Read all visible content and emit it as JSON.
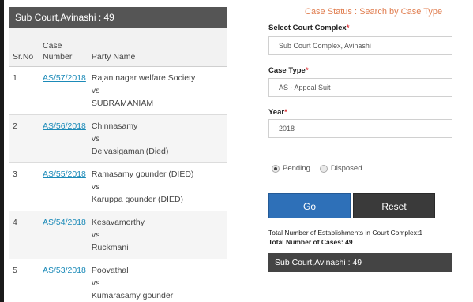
{
  "left": {
    "header": "Sub Court,Avinashi : 49",
    "columns": {
      "sr": "Sr.No",
      "case_line1": "Case",
      "case_line2": "Number",
      "party": "Party Name"
    },
    "rows": [
      {
        "sr": "1",
        "case": "AS/57/2018",
        "p1": "Rajan nagar welfare Society",
        "vs": "vs",
        "p2": "SUBRAMANIAM"
      },
      {
        "sr": "2",
        "case": "AS/56/2018",
        "p1": "Chinnasamy",
        "vs": "vs",
        "p2": "Deivasigamani(Died)"
      },
      {
        "sr": "3",
        "case": "AS/55/2018",
        "p1": "Ramasamy gounder (DIED)",
        "vs": "vs",
        "p2": "Karuppa gounder (DIED)"
      },
      {
        "sr": "4",
        "case": "AS/54/2018",
        "p1": "Kesavamorthy",
        "vs": "vs",
        "p2": "Ruckmani"
      },
      {
        "sr": "5",
        "case": "AS/53/2018",
        "p1": "Poovathal",
        "vs": "vs",
        "p2": "Kumarasamy gounder"
      }
    ]
  },
  "right": {
    "title": "Case Status : Search by Case Type",
    "court_complex": {
      "label": "Select Court Complex",
      "required": "*",
      "value": "Sub Court Complex, Avinashi"
    },
    "case_type": {
      "label": "Case Type",
      "required": "*",
      "value": "AS - Appeal Suit"
    },
    "year": {
      "label": "Year",
      "required": "*",
      "value": "2018"
    },
    "radio": {
      "pending": "Pending",
      "disposed": "Disposed",
      "selected": "pending"
    },
    "buttons": {
      "go": "Go",
      "reset": "Reset"
    },
    "total_establishments": "Total Number of Establishments in Court Complex:1",
    "total_cases": "Total Number of Cases: 49",
    "footer": "Sub Court,Avinashi : 49"
  },
  "colors": {
    "link": "#1b8ab8",
    "title": "#e07d4f",
    "go_button": "#2e70b8",
    "reset_button": "#3a3a3a",
    "header_bar": "#555555"
  }
}
